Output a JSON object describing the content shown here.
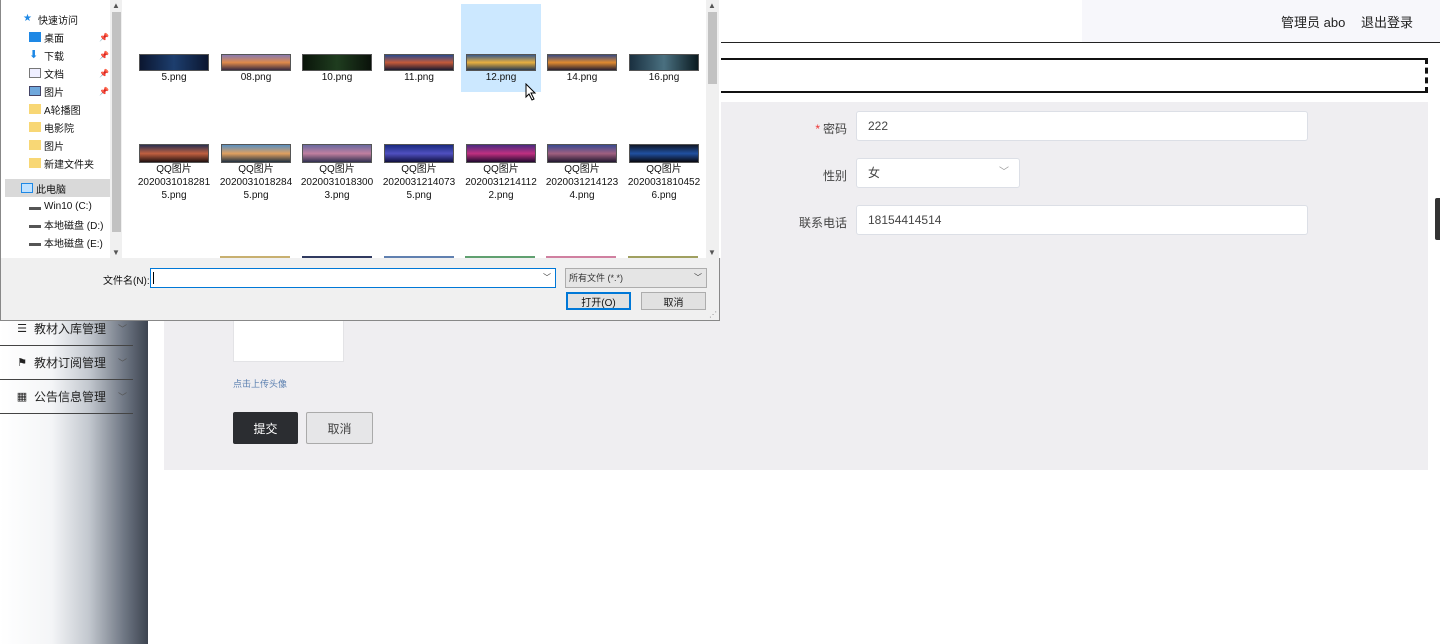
{
  "header": {
    "user_label": "管理员 abo",
    "logout_label": "退出登录"
  },
  "sidebar": {
    "items": [
      {
        "label": "教材入库管理",
        "icon": "list-icon"
      },
      {
        "label": "教材订阅管理",
        "icon": "flag-icon"
      },
      {
        "label": "公告信息管理",
        "icon": "grid-icon"
      }
    ]
  },
  "form": {
    "password_label": "密码",
    "password_value": "222",
    "gender_label": "性别",
    "gender_value": "女",
    "phone_label": "联系电话",
    "phone_value": "18154414514",
    "upload_hint": "点击上传头像",
    "submit_label": "提交",
    "cancel_label": "取消"
  },
  "dialog": {
    "nav": [
      {
        "label": "快速访问",
        "icon": "star-icon",
        "pinned": false
      },
      {
        "label": "桌面",
        "icon": "desktop-icon",
        "pinned": true
      },
      {
        "label": "下载",
        "icon": "download-icon",
        "pinned": true
      },
      {
        "label": "文档",
        "icon": "document-icon",
        "pinned": true
      },
      {
        "label": "图片",
        "icon": "pictures-icon",
        "pinned": true
      },
      {
        "label": "A轮播图",
        "icon": "folder-icon",
        "pinned": false
      },
      {
        "label": "电影院",
        "icon": "folder-icon",
        "pinned": false
      },
      {
        "label": "图片",
        "icon": "folder-icon",
        "pinned": false
      },
      {
        "label": "新建文件夹",
        "icon": "folder-icon",
        "pinned": false
      },
      {
        "label": "此电脑",
        "icon": "computer-icon",
        "pinned": false
      },
      {
        "label": "Win10 (C:)",
        "icon": "drive-icon",
        "pinned": false
      },
      {
        "label": "本地磁盘 (D:)",
        "icon": "drive-icon",
        "pinned": false
      },
      {
        "label": "本地磁盘 (E:)",
        "icon": "drive-icon",
        "pinned": false
      }
    ],
    "files_row1": [
      "5.png",
      "08.png",
      "10.png",
      "11.png",
      "12.png",
      "14.png",
      "16.png"
    ],
    "files_row2": [
      [
        "QQ图片",
        "2020031018281",
        "5.png"
      ],
      [
        "QQ图片",
        "2020031018284",
        "5.png"
      ],
      [
        "QQ图片",
        "2020031018300",
        "3.png"
      ],
      [
        "QQ图片",
        "2020031214073",
        "5.png"
      ],
      [
        "QQ图片",
        "2020031214112",
        "2.png"
      ],
      [
        "QQ图片",
        "2020031214123",
        "4.png"
      ],
      [
        "QQ图片",
        "2020031810452",
        "6.png"
      ]
    ],
    "filename_label": "文件名(N):",
    "filename_value": "",
    "filetype_value": "所有文件 (*.*)",
    "open_label": "打开(O)",
    "cancel_label": "取消",
    "selected_file": "12.png"
  }
}
